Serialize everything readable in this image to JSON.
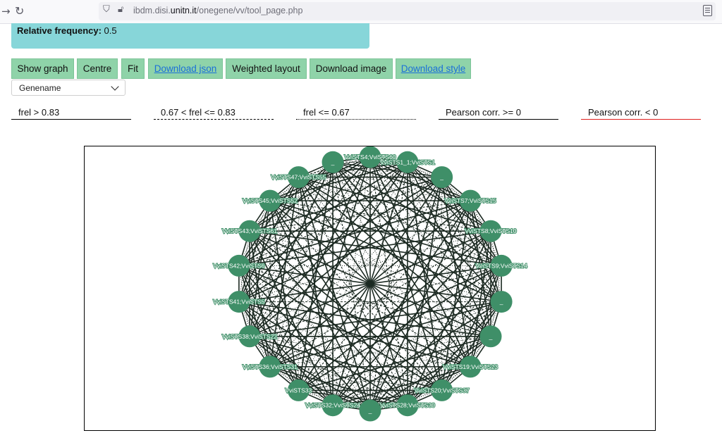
{
  "browser": {
    "url_prefix": "ibdm.disi.",
    "url_host": "unitn.it",
    "url_path": "/onegene/vv/tool_page.php"
  },
  "summary": {
    "label": "Relative frequency:",
    "value": " 0.5"
  },
  "toolbar": {
    "show_graph": "Show graph",
    "centre": "Centre",
    "fit": "Fit",
    "download_json": "Download json",
    "weighted_layout": "Weighted layout",
    "download_image": "Download image",
    "download_style": "Download style"
  },
  "label_select": {
    "selected": "Genename"
  },
  "legend": {
    "strong": "frel > 0.83",
    "medium": "0.67 < frel <= 0.83",
    "weak": "frel <= 0.67",
    "positive": "Pearson corr. >= 0",
    "negative": "Pearson corr. < 0",
    "negative_color": "#e0201e"
  },
  "graph": {
    "node_color": "#3f8f68",
    "edge_color": "#1c2a22",
    "nodes": [
      "VviSTS4;VviSTS60",
      "VviSTS1_1;VviSTS1",
      "_",
      "VviSTS7;VviSTS15",
      "VviSTS8;VviSTS10",
      "VviSTS9;VviSTS14",
      "_",
      "_",
      "VviSTS19;VviSTS23",
      "VviSTS20;VviSTS37",
      "VviSTS28;VviSTS30",
      "_",
      "VviSTS32;VviSTS24",
      "VviSTS33",
      "VviSTS36;VviSTS31",
      "VviSTS38;VviSTS22",
      "VviSTS41;VviSTS5",
      "VviSTS42;VviSTS6",
      "VviSTS43;VviSTS61",
      "VviSTS45;VviSTS52",
      "VviSTS47;VviSTS55",
      "_"
    ]
  }
}
